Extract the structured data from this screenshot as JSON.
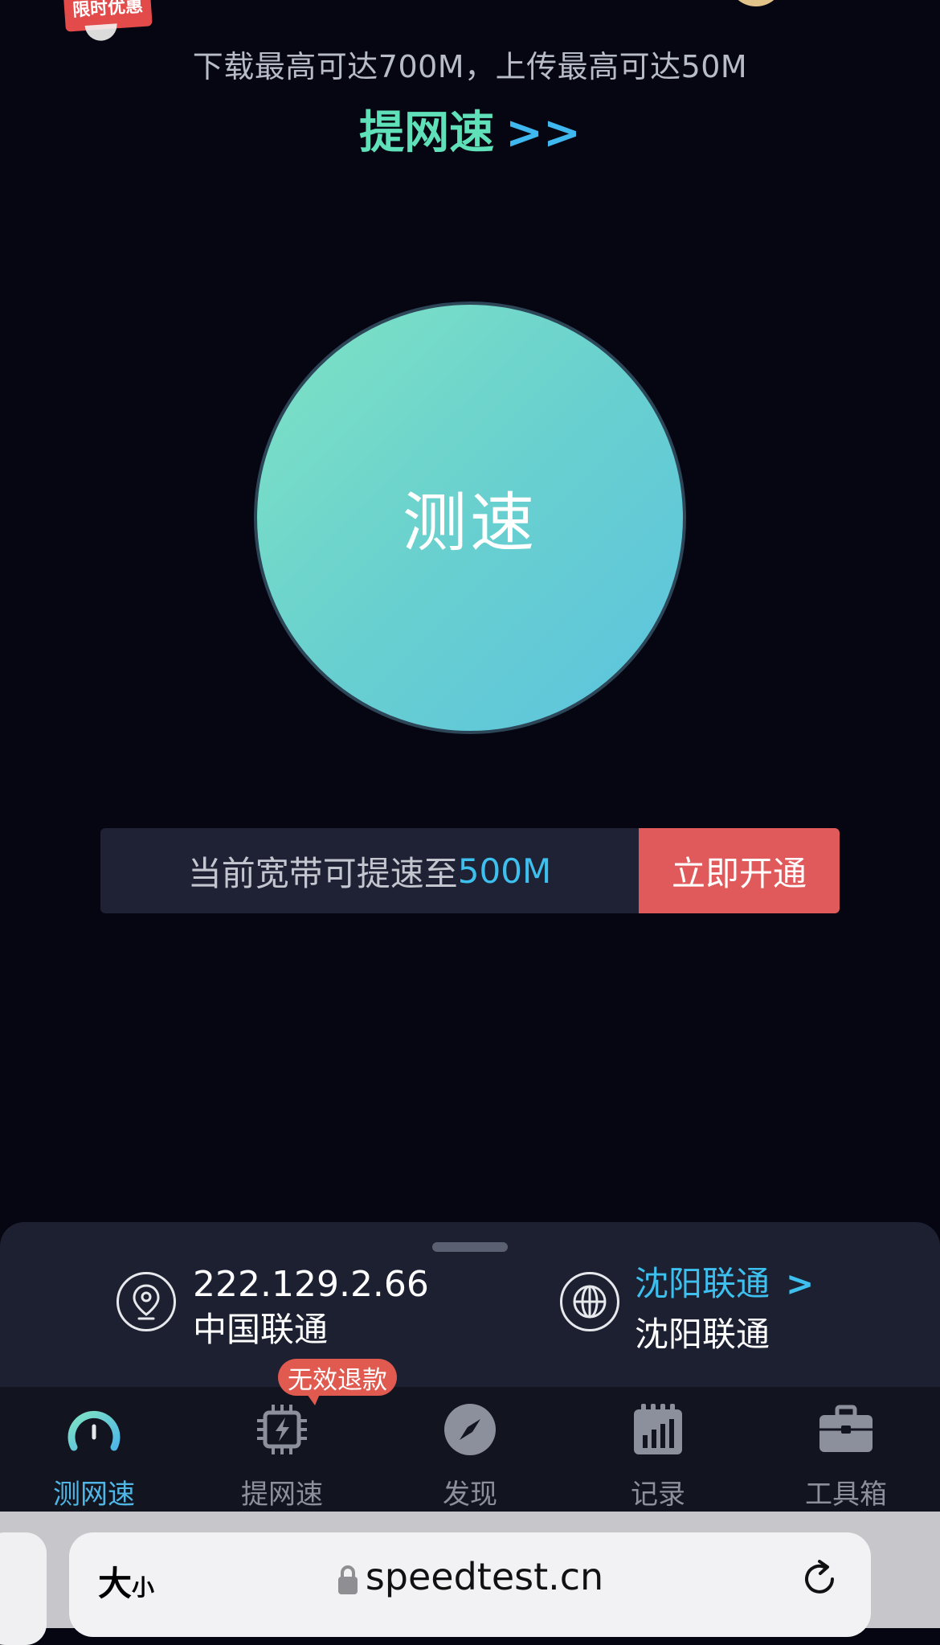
{
  "top": {
    "promo_badge": "限时优惠",
    "headline": "下载最高可达700M，上传最高可达50M",
    "boost_link": "提网速",
    "boost_arrow": ">>"
  },
  "speed_button": {
    "label": "测速"
  },
  "promo_bar": {
    "text": "当前宽带可提速至",
    "value": "500M",
    "cta": "立即开通"
  },
  "info": {
    "ip": "222.129.2.66",
    "ip_isp": "中国联通",
    "server_link": "沈阳联通",
    "server_arrow": ">",
    "server_name": "沈阳联通"
  },
  "tabbar": {
    "badge": "无效退款",
    "tabs": [
      {
        "label": "测网速",
        "icon": "speedometer-icon",
        "active": true
      },
      {
        "label": "提网速",
        "icon": "chip-bolt-icon"
      },
      {
        "label": "发现",
        "icon": "compass-icon"
      },
      {
        "label": "记录",
        "icon": "calendar-chart-icon"
      },
      {
        "label": "工具箱",
        "icon": "toolbox-icon"
      }
    ]
  },
  "browser": {
    "text_size_big": "大",
    "text_size_small": "小",
    "url": "speedtest.cn"
  },
  "colors": {
    "background": "#060612",
    "accent_blue": "#3ec0ef",
    "accent_green": "#5fe0b8",
    "cta_red": "#e05a5b"
  }
}
